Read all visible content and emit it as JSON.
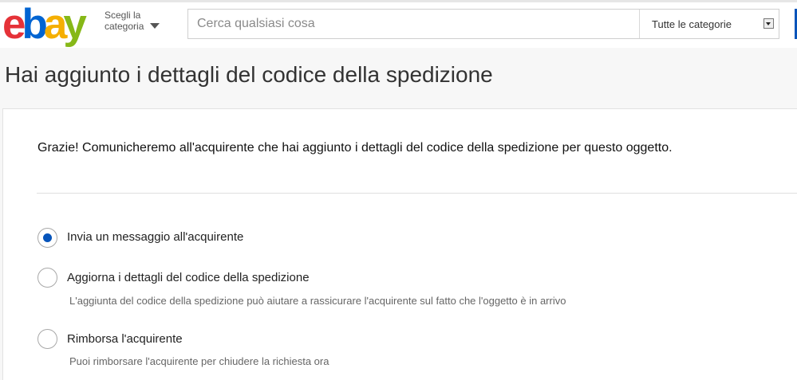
{
  "header": {
    "logo": {
      "e": "e",
      "b": "b",
      "a": "a",
      "y": "y",
      "colors": [
        "#e53238",
        "#0064d2",
        "#f5af02",
        "#86b817"
      ]
    },
    "category_menu": {
      "line1": "Scegli la",
      "line2": "categoria",
      "icon": "caret-down-icon"
    },
    "search": {
      "placeholder": "Cerca qualsiasi cosa",
      "value": ""
    },
    "category_select": {
      "selected": "Tutte le categorie"
    }
  },
  "page": {
    "title": "Hai aggiunto i dettagli del codice della spedizione",
    "thanks": "Grazie! Comunicheremo all'acquirente che hai aggiunto i dettagli del codice della spedizione per questo oggetto.",
    "options": [
      {
        "label": "Invia un messaggio all'acquirente",
        "selected": true,
        "description": ""
      },
      {
        "label": "Aggiorna i dettagli del codice della spedizione",
        "selected": false,
        "description": "L'aggiunta del codice della spedizione può aiutare a rassicurare l'acquirente sul fatto che l'oggetto è in arrivo"
      },
      {
        "label": "Rimborsa l'acquirente",
        "selected": false,
        "description": "Puoi rimborsare l'acquirente per chiudere la richiesta ora"
      }
    ]
  },
  "colors": {
    "accent": "#0654ba",
    "page_bg": "#f7f7f7"
  }
}
